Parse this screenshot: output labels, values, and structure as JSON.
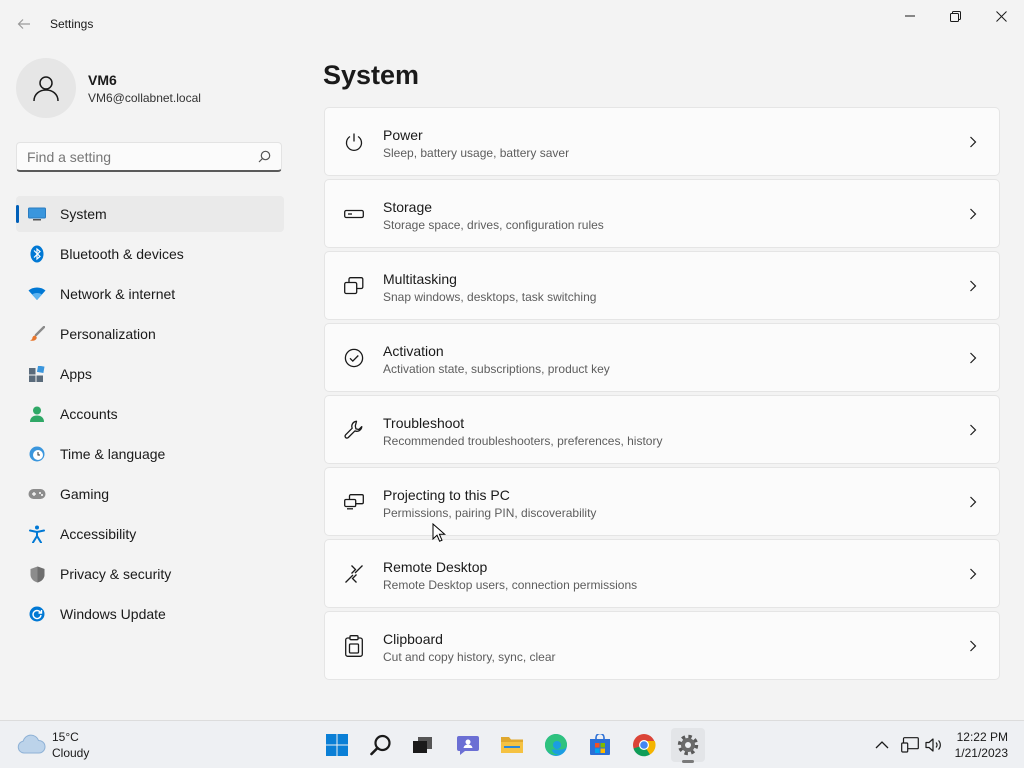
{
  "window": {
    "title": "Settings"
  },
  "profile": {
    "name": "VM6",
    "email": "VM6@collabnet.local"
  },
  "search": {
    "placeholder": "Find a setting",
    "value": ""
  },
  "sidebar": {
    "items": [
      {
        "label": "System",
        "icon": "monitor-icon",
        "active": true
      },
      {
        "label": "Bluetooth & devices",
        "icon": "bluetooth-icon"
      },
      {
        "label": "Network & internet",
        "icon": "wifi-icon"
      },
      {
        "label": "Personalization",
        "icon": "brush-icon"
      },
      {
        "label": "Apps",
        "icon": "apps-icon"
      },
      {
        "label": "Accounts",
        "icon": "person-icon"
      },
      {
        "label": "Time & language",
        "icon": "globe-clock-icon"
      },
      {
        "label": "Gaming",
        "icon": "gamepad-icon"
      },
      {
        "label": "Accessibility",
        "icon": "accessibility-icon"
      },
      {
        "label": "Privacy & security",
        "icon": "shield-icon"
      },
      {
        "label": "Windows Update",
        "icon": "update-icon"
      }
    ]
  },
  "main": {
    "title": "System",
    "cards": [
      {
        "title": "Power",
        "subtitle": "Sleep, battery usage, battery saver",
        "icon": "power-icon"
      },
      {
        "title": "Storage",
        "subtitle": "Storage space, drives, configuration rules",
        "icon": "storage-icon"
      },
      {
        "title": "Multitasking",
        "subtitle": "Snap windows, desktops, task switching",
        "icon": "multitasking-icon"
      },
      {
        "title": "Activation",
        "subtitle": "Activation state, subscriptions, product key",
        "icon": "activation-icon"
      },
      {
        "title": "Troubleshoot",
        "subtitle": "Recommended troubleshooters, preferences, history",
        "icon": "wrench-icon"
      },
      {
        "title": "Projecting to this PC",
        "subtitle": "Permissions, pairing PIN, discoverability",
        "icon": "projecting-icon"
      },
      {
        "title": "Remote Desktop",
        "subtitle": "Remote Desktop users, connection permissions",
        "icon": "remote-desktop-icon"
      },
      {
        "title": "Clipboard",
        "subtitle": "Cut and copy history, sync, clear",
        "icon": "clipboard-icon"
      }
    ]
  },
  "taskbar": {
    "weather": {
      "temp": "15°C",
      "condition": "Cloudy"
    },
    "apps": [
      "windows-start-icon",
      "search-icon",
      "task-view-icon",
      "chat-icon",
      "file-explorer-icon",
      "edge-icon",
      "store-icon",
      "chrome-icon",
      "settings-gear-icon"
    ],
    "clock": {
      "time": "12:22 PM",
      "date": "1/21/2023"
    }
  },
  "colors": {
    "accent": "#005fb8",
    "background": "#f3f3f3",
    "card": "#fbfbfb"
  }
}
